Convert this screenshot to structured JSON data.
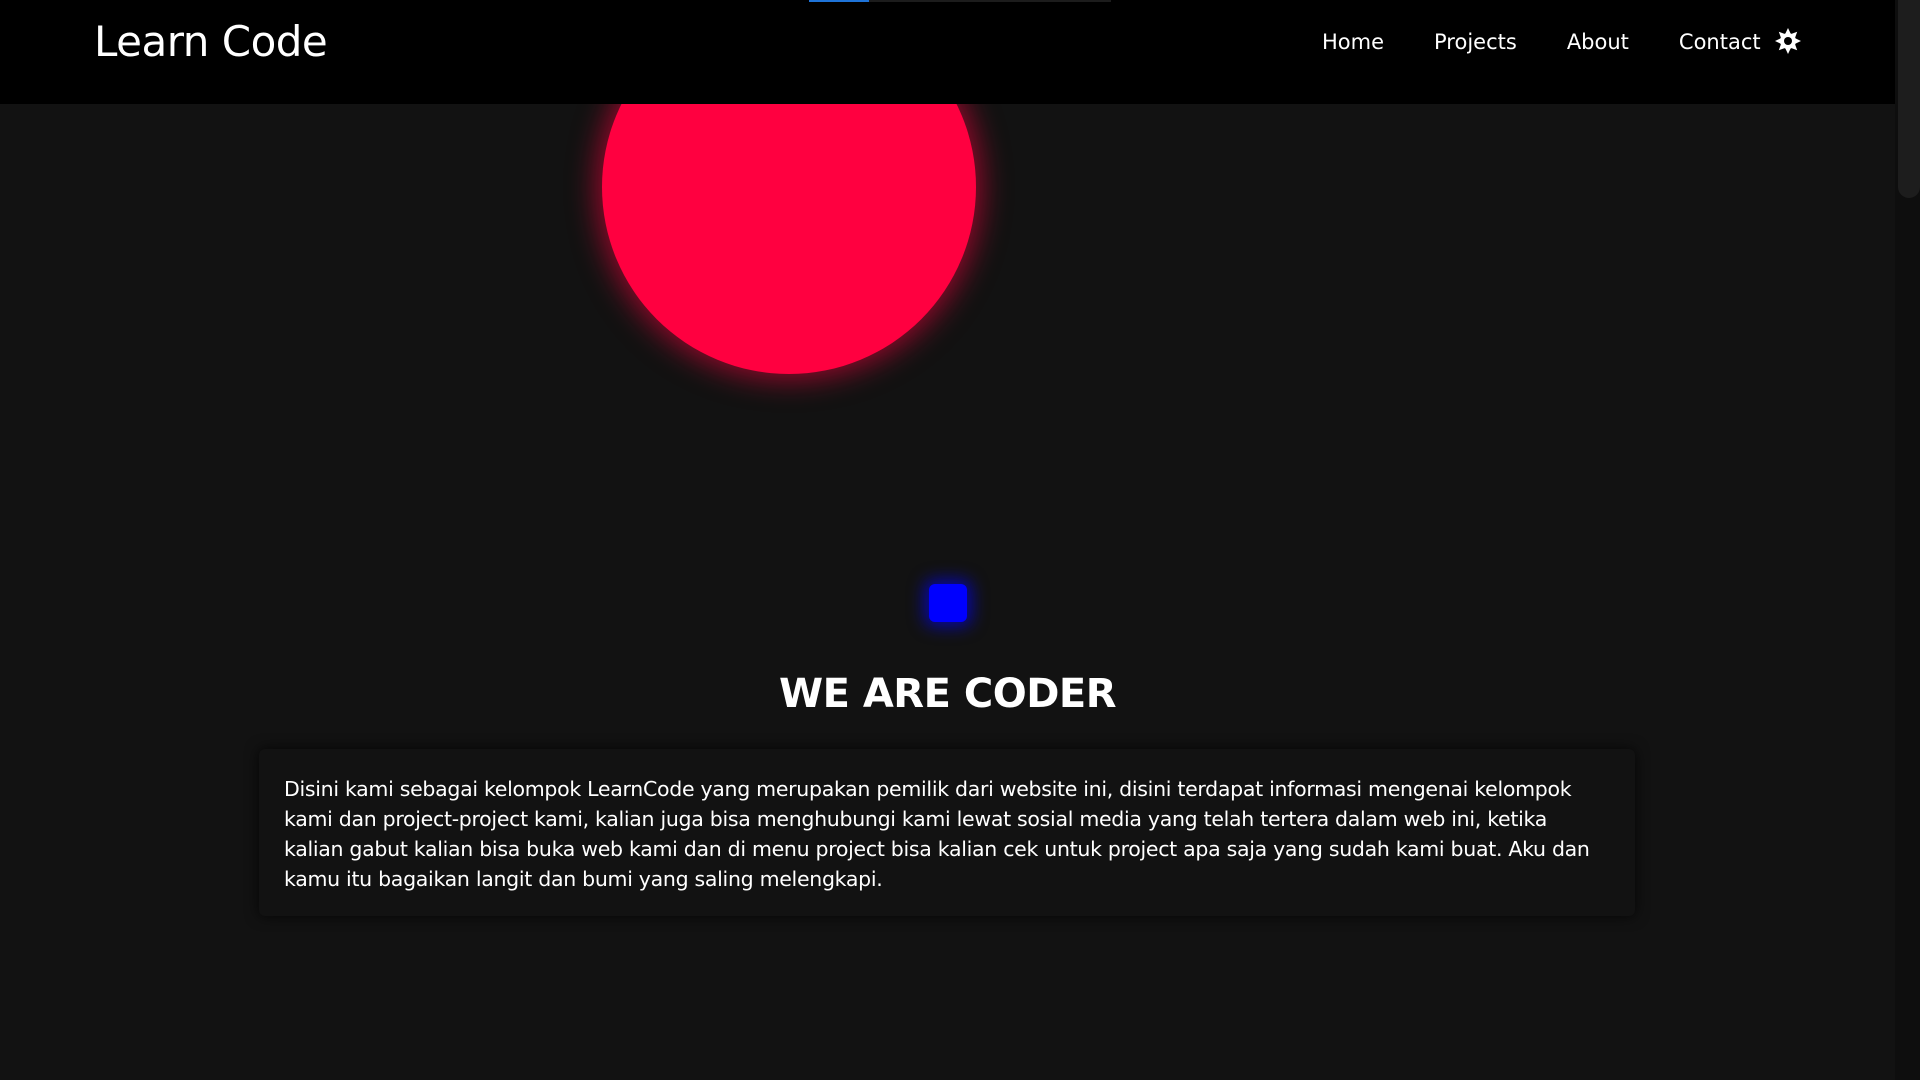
{
  "header": {
    "brand": "Learn Code",
    "nav": [
      "Home",
      "Projects",
      "About",
      "Contact"
    ],
    "theme_toggle_icon": "sun-icon",
    "scroll_progress": 0.2
  },
  "about": {
    "title": "WE ARE CODER",
    "description": "Disini kami sebagai kelompok LearnCode yang merupakan pemilik dari website ini, disini terdapat informasi mengenai kelompok kami dan project-project kami, kalian juga bisa menghubungi kami lewat sosial media yang telah tertera dalam web ini, ketika kalian gabut kalian bisa buka web kami dan di menu project bisa kalian cek untuk project apa saja yang sudah kami buat. Aku dan kamu itu bagaikan langit dan bumi yang saling melengkapi."
  },
  "colors": {
    "background": "#121212",
    "header": "#000000",
    "red_orb": "#ff0040",
    "blue_square": "#0000ff",
    "progress": "#1e73d8"
  }
}
